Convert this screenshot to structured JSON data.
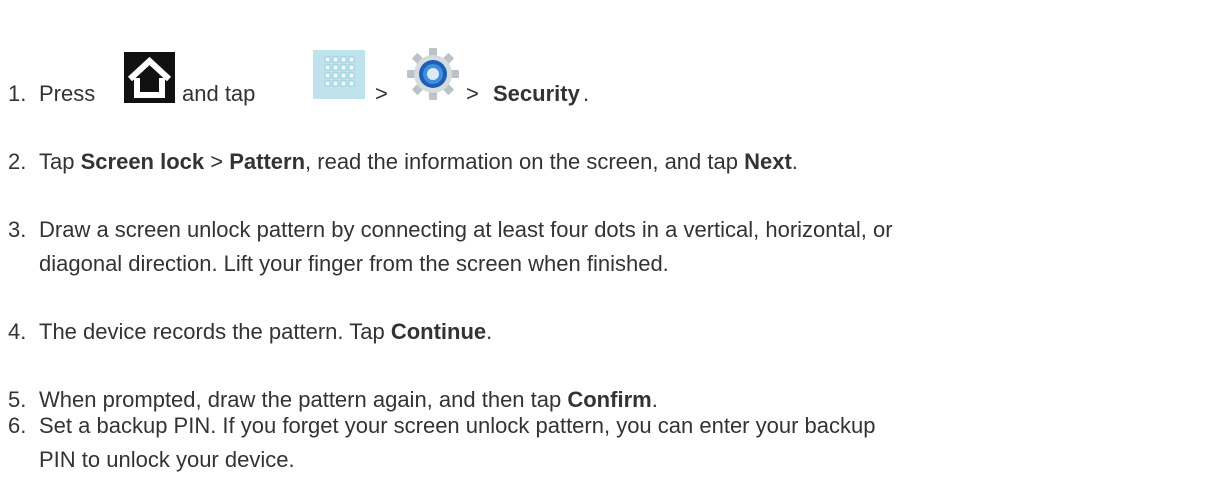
{
  "steps": [
    {
      "number": "1.",
      "parts": {
        "press": "Press",
        "and_tap": "and tap",
        "sep1": ">",
        "sep2": ">",
        "security": "Security",
        "period": "."
      },
      "icons": [
        "home-icon",
        "apps-grid-icon",
        "settings-gear-icon"
      ]
    },
    {
      "number": "2.",
      "parts": {
        "a": "Tap",
        "screen_lock": "Screen lock",
        "b": ">",
        "pattern": "Pattern",
        "c": ", read the information on the screen, and tap",
        "next": "Next",
        "d": "."
      }
    },
    {
      "number": "3.",
      "line1": "Draw a screen unlock pattern by connecting at least four dots in a vertical, horizontal, or",
      "line2": "diagonal direction. Lift your finger from the screen when finished."
    },
    {
      "number": "4.",
      "parts": {
        "a": "The device records the pattern. Tap",
        "continue": "Continue",
        "b": "."
      }
    },
    {
      "number": "5.",
      "parts": {
        "a": "When prompted, draw the pattern again, and then tap",
        "confirm": "Confirm",
        "b": "."
      }
    },
    {
      "number": "6.",
      "line1": "Set a backup PIN. If you forget your screen unlock pattern, you can enter your backup",
      "line2": "PIN to unlock your device."
    }
  ]
}
